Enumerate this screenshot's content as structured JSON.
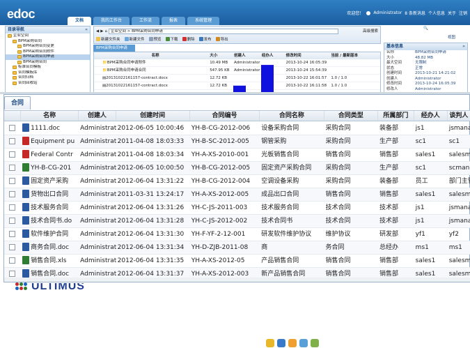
{
  "app": {
    "logo": "edoc",
    "welcome": "欢迎您！",
    "user": "Administrator",
    "links": [
      "8 条新消息",
      "个人信息",
      "关于",
      "注销"
    ]
  },
  "top_tabs": [
    "文档",
    "我的工作台",
    "工作流",
    "报表",
    "系统管理"
  ],
  "tree": {
    "title": "目录导航",
    "nodes": [
      "企业空间",
      "BPM采购合同",
      "BPM采购合同变更",
      "BPM采购合同附件",
      "BPM采购合同申请",
      "BPM采购合同",
      "标准合同模板",
      "合同模板库",
      "合同归档",
      "合同回收站"
    ]
  },
  "center": {
    "path": "企业空间 > BPM采购合同申请",
    "advanced": "高级搜索",
    "toolbar": [
      "新建文件夹",
      "新建文件",
      "预览",
      "下载",
      "删除",
      "发布",
      "导出"
    ]
  },
  "file_tab": "BPM采购合同申请",
  "filelist": {
    "headers": [
      "名称",
      "大小",
      "创建人",
      "经办人",
      "修改时间",
      "当前 / 最新版本"
    ],
    "rows": [
      [
        "BPM采购合同申请附件",
        "10.49 MB",
        "Administrator",
        "",
        "2013-10-24 16:05:39",
        ""
      ],
      [
        "BPM采购合同申请合同",
        "547.95 KB",
        "Administrator",
        "",
        "2013-10-24 15:54:39",
        ""
      ],
      [
        "20131022161157-contract.docx",
        "12.72 KB",
        "",
        "",
        "2013-10-22 16:01:57",
        "1.0 / 1.0"
      ],
      [
        "20131022161157-contract.docx",
        "12.72 KB",
        "",
        "",
        "2013-10-22 16:11:58",
        "1.0 / 1.0"
      ]
    ]
  },
  "info": {
    "title": "基本信息",
    "view": "视图",
    "rows": [
      [
        "名称",
        "BPM采购合同申请"
      ],
      [
        "大小",
        "48.82 MB"
      ],
      [
        "最大空间",
        "无限制"
      ],
      [
        "状态",
        "正常"
      ],
      [
        "创建时间",
        "2013-10-21 14:21:02"
      ],
      [
        "创建人",
        "Administrator"
      ],
      [
        "修改时间",
        "2013-10-24 16:05:39"
      ],
      [
        "修改人",
        "Administrator"
      ]
    ]
  },
  "main": {
    "tab": "合同",
    "headers": [
      "",
      "名称",
      "创建人",
      "创建时间",
      "合同编号",
      "合同名称",
      "合同类型",
      "所属部门",
      "经办人",
      "谈判人"
    ],
    "rows": [
      [
        "doc",
        "1111.doc",
        "Administrator",
        "2012-06-05 10:00:46",
        "YH-B-CG-2012-006",
        "设备采购合同",
        "采购合同",
        "装备部",
        "js1",
        "jsmana"
      ],
      [
        "pdf",
        "Equipment pu",
        "Administrator",
        "2011-04-08 18:03:33",
        "YH-B-SC-2012-005",
        "钢管采购",
        "采购合同",
        "生产部",
        "sc1",
        "sc1"
      ],
      [
        "pdf",
        "Federal Contr",
        "Administrator",
        "2011-04-08 18:03:34",
        "YH-A-XS-2010-001",
        "光板销售合同",
        "销售合同",
        "销售部",
        "sales1",
        "salesm"
      ],
      [
        "xls",
        "YH-B-CG-201",
        "Administrator",
        "2012-06-05 10:00:50",
        "YH-B-CG-2012-005",
        "固定资产采购合同",
        "采购合同",
        "生产部",
        "sc1",
        "scmana"
      ],
      [
        "doc",
        "固定资产采购",
        "Administrator",
        "2012-06-04 13:31:22",
        "YH-B-CG-2012-004",
        "空调设备采购",
        "采购合同",
        "装备部",
        "员工",
        "部门主管"
      ],
      [
        "doc",
        "货物出口合同",
        "Administrator",
        "2011-03-31 13:24:17",
        "YH-A-XS-2012-005",
        "成品出口合同",
        "销售合同",
        "销售部",
        "sales1",
        "salesm"
      ],
      [
        "doc",
        "技术服务合同",
        "Administrator",
        "2012-06-04 13:31:26",
        "YH-C-JS-2011-003",
        "技术服务合同",
        "技术合同",
        "技术部",
        "js1",
        "jsmana"
      ],
      [
        "doc",
        "技术合同书.do",
        "Administrator",
        "2012-06-04 13:31:28",
        "YH-C-JS-2012-002",
        "技术合同书",
        "技术合同",
        "技术部",
        "js1",
        "jsmana"
      ],
      [
        "doc",
        "软件维护合同",
        "Administrator",
        "2012-06-04 13:31:30",
        "YH-F-YF-2-12-001",
        "研发软件维护协议",
        "维护协议",
        "研发部",
        "yf1",
        "yf2"
      ],
      [
        "doc",
        "商务合同.doc",
        "Administrator",
        "2012-06-04 13:31:34",
        "YH-D-ZJB-2011-08",
        "商",
        "务合同",
        "总经办",
        "ms1",
        "ms1"
      ],
      [
        "xls",
        "销售合同.xls",
        "Administrator",
        "2012-06-04 13:31:35",
        "YH-A-XS-2012-05",
        "产品销售合同",
        "销售合同",
        "销售部",
        "sales1",
        "salesm"
      ],
      [
        "doc",
        "销售合同.doc",
        "Administrator",
        "2012-06-04 13:31:37",
        "YH-A-XS-2012-003",
        "新产品销售合同",
        "销售合同",
        "销售部",
        "sales1",
        "salesm"
      ]
    ]
  },
  "footer_logo": "ULTIMUS",
  "colors": {
    "brand": "#1b5d9e",
    "doc_icon": "#2c5aa0",
    "pdf_icon": "#c62828",
    "xls_icon": "#2e7d32",
    "bar_blue": "#1010e0"
  },
  "chart_data": {
    "type": "bar",
    "title": "",
    "categories": [
      "",
      "",
      "",
      ""
    ],
    "values": [
      85,
      0,
      30,
      18
    ]
  }
}
